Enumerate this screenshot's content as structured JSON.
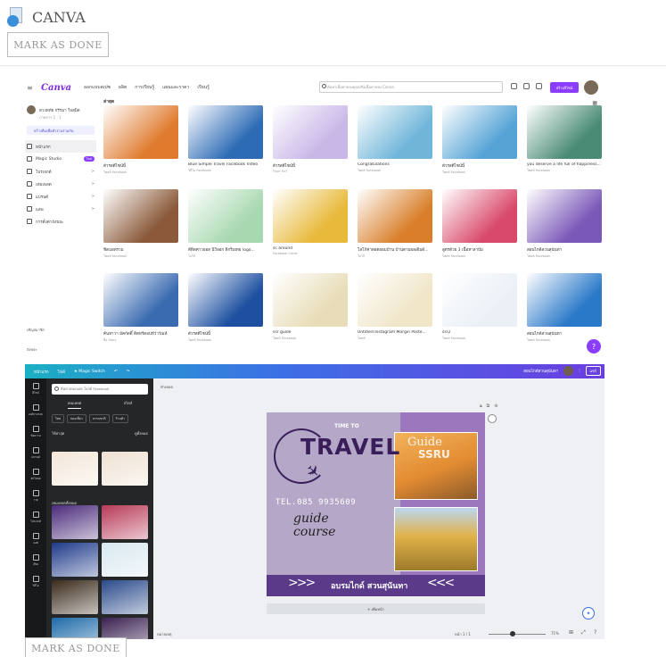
{
  "lesson": {
    "title": "CANVA",
    "mark_done": "MARK AS DONE"
  },
  "home": {
    "nav": [
      "ออกแบบสเปซ",
      "ผลิต",
      "การเรียนรู้",
      "แผนและราคา",
      "เรียนรู้"
    ],
    "logo": "Canva",
    "search_placeholder": "ค้นหาเนื้อหาของคุณหรือเนื้อหาของ Canva",
    "create_button": "สร้างดีไซน์",
    "account_name": "ดวงหทัย กรีรมา ใจสุมิต",
    "account_sub": "ภาคการ 1 : 1",
    "team_button": "สร้างทีมเพื่อทำงานร่วมกัน",
    "sidebar": [
      {
        "label": "หน้าแรก",
        "badge": "",
        "chev": ""
      },
      {
        "label": "Magic Studio",
        "badge": "ใหม่",
        "chev": ""
      },
      {
        "label": "โปรเจกต์",
        "badge": "",
        "chev": ">"
      },
      {
        "label": "เทมเพลต",
        "badge": "",
        "chev": ">"
      },
      {
        "label": "แบรนด์",
        "badge": "",
        "chev": ">"
      },
      {
        "label": "แอพ",
        "badge": "",
        "chev": ">"
      },
      {
        "label": "การตั้งค่าถังขยะ",
        "badge": "",
        "chev": ""
      }
    ],
    "sidebar_bottom": [
      "เชิญสมาชิก",
      "ถังขยะ"
    ],
    "section_title": "ล่าสุด",
    "cards": [
      {
        "title": "ตัวรสดีไซน์นี้",
        "sub": "โพสต์ Facebook"
      },
      {
        "title": "Blue Simple Travel Facebook Video",
        "sub": "วิดีโอ Facebook"
      },
      {
        "title": "ตัวรสดีไซน์นี้",
        "sub": "Flyer 5x7"
      },
      {
        "title": "Congratulations",
        "sub": "โพสต์ Facebook"
      },
      {
        "title": "ตัวรสดีไซน์นี้",
        "sub": "โพสต์ Facebook"
      },
      {
        "title": "you deserve a life full of happiness...",
        "sub": "โพสต์ Facebook"
      },
      {
        "title": "ฟีดบอทรวม",
        "sub": "โพสต์ Facebook"
      },
      {
        "title": "ดีดิตค่าวยอส นิวิลอก ดิกริเยทธ logo...",
        "sub": "โลโก้"
      },
      {
        "title": "sc around",
        "sub": "Facebook Cover"
      },
      {
        "title": "โลโก้ค่าดอดยอมบ้าน บ้านตามผลเดิมด์...",
        "sub": "โลโก้"
      },
      {
        "title": "สูตรด้วย 3 เนื้อหาลาบ้ม",
        "sub": "โพสต์ Facebook"
      },
      {
        "title": "สอนไกด์สวนสุนันทา",
        "sub": "โพสต์ Facebook"
      },
      {
        "title": "ค้นหาวา มัคกัดดิ์ ดิตทร์ตอปหัว่าวัณห์",
        "sub": "สื่อ Story"
      },
      {
        "title": "ตัวรสดีไซน์นี้",
        "sub": "โพสต์ Facebook"
      },
      {
        "title": "ssr guide",
        "sub": "โพสต์ Facebook"
      },
      {
        "title": "Untitled Instagram Margin Poste...",
        "sub": "โพสต์"
      },
      {
        "title": "ssr2",
        "sub": "โพสต์ Facebook"
      },
      {
        "title": "สอนไกด์สวนสุนันทา",
        "sub": "โพสต์ Facebook"
      }
    ],
    "card_colors": [
      "#e07b2e",
      "#2d6bb5",
      "#c9b7e8",
      "#6fb6d9",
      "#56a4d6",
      "#4a8b76",
      "#8a5a3a",
      "#a8d8b0",
      "#e8b93a",
      "#d97f2a",
      "#d94a6a",
      "#7a58b8",
      "#3a6ab0",
      "#1e4fa0",
      "#e8ddb8",
      "#f0e6c8",
      "#eaf0f6",
      "#2a78c8"
    ],
    "help": "?"
  },
  "editor": {
    "topbar": [
      "หน้าแรก",
      "ไฟล์",
      "★ Magic Switch"
    ],
    "design_name": "สอนไกด์สวนสุนันทา",
    "share": "แชร์",
    "search_placeholder": "ค้นหาเทมเพลต โพสต์ Facebook",
    "tabs": [
      "เทมเพลต",
      "สไตล์"
    ],
    "chips": [
      "ไทย",
      "ท่องเที่ยว",
      "ธรรมชาติ",
      "ร้านค้า"
    ],
    "section_recent": "ใช้ล่าสุด",
    "section_recent_all": "ดูทั้งหมด",
    "section_all": "เทมเพลตทั้งหมด",
    "rail": [
      "ดีไซน์",
      "องค์ประกอบ",
      "ข้อความ",
      "แบรนด์",
      "อัปโหลด",
      "วาด",
      "โปรเจกต์",
      "แอพ",
      "เสียง",
      "วิดีโอ"
    ],
    "tile_colors": [
      "#f3e6d8",
      "#efe1d2",
      "#4a2a7a",
      "#b83a58",
      "#1f3a8a",
      "#d8e8f0",
      "#3a2a1a",
      "#2a4a8a",
      "#1e6aa8",
      "#3a2050"
    ],
    "crumb": "ทำเพลต",
    "poster": {
      "time_to": "TIME TO",
      "travel": "TRAVEL",
      "tel": "TEL.085 9935609",
      "guide_line1": "guide",
      "guide_line2": "course",
      "photo_title": "Guide",
      "photo_sub": "SSRU",
      "banner": "อบรมไกด์ สวนสุนันทา",
      "arrows_left": ">>>",
      "arrows_right": "<<<"
    },
    "add_page": "+ เพิ่มหน้า",
    "notes": "หมายเหตุ",
    "page_counter": "หน้า 1 / 1",
    "zoom": "71%",
    "magic_icon": "✦"
  }
}
